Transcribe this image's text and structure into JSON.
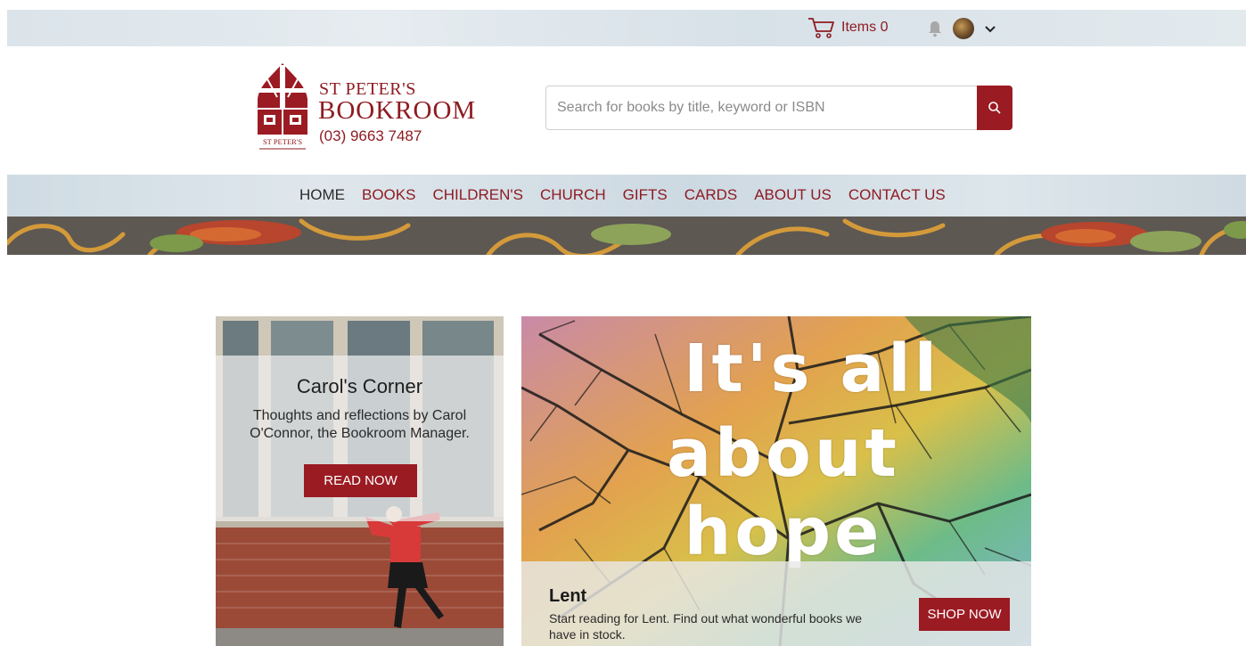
{
  "topbar": {
    "cart_label": "Items 0"
  },
  "brand": {
    "line1": "ST PETER'S",
    "line2": "BOOKROOM",
    "phone": "(03) 9663 7487",
    "logo_caption": "ST PETER'S"
  },
  "search": {
    "placeholder": "Search for books by title, keyword or ISBN"
  },
  "nav": {
    "items": [
      {
        "label": "HOME",
        "active": true
      },
      {
        "label": "BOOKS"
      },
      {
        "label": "CHILDREN'S"
      },
      {
        "label": "CHURCH"
      },
      {
        "label": "GIFTS"
      },
      {
        "label": "CARDS"
      },
      {
        "label": "ABOUT US"
      },
      {
        "label": "CONTACT US"
      }
    ]
  },
  "carol": {
    "title": "Carol's Corner",
    "text": "Thoughts and reflections by Carol O'Connor, the Bookroom Manager.",
    "button": "READ NOW"
  },
  "lent": {
    "banner_line1": "It's all",
    "banner_line2": "about",
    "banner_line3": "hope",
    "title": "Lent",
    "text": "Start reading for Lent. Find out what wonderful books we have in stock.",
    "button": "SHOP NOW"
  },
  "colors": {
    "brand_red": "#8e1b22",
    "button_red": "#9b1b23"
  }
}
